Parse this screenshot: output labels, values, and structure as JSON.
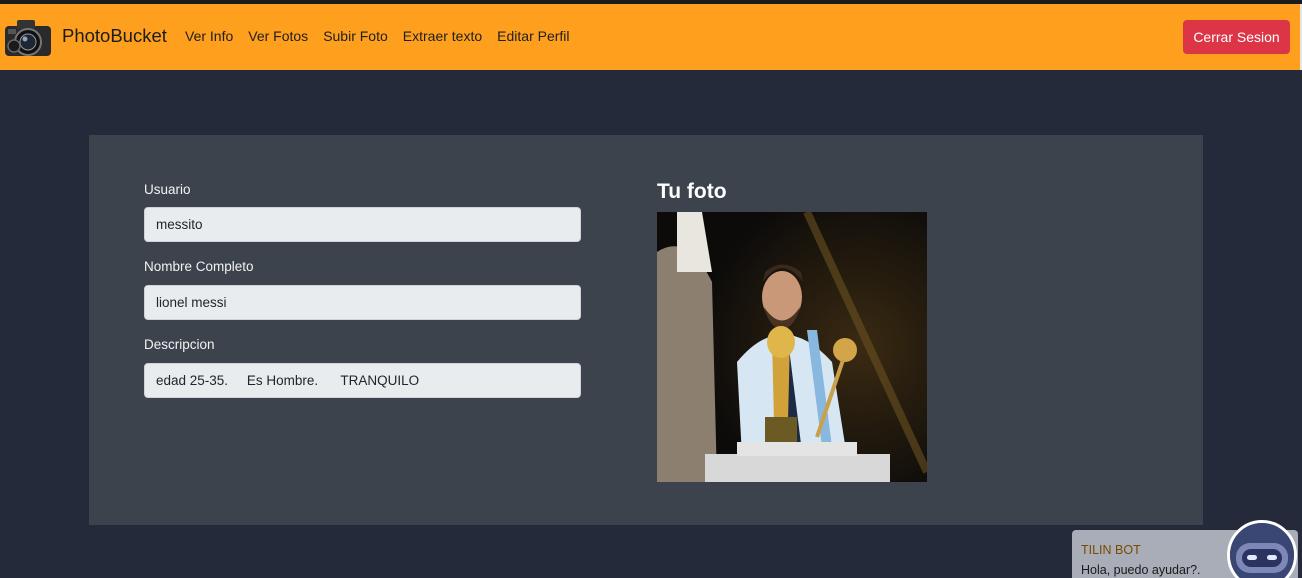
{
  "navbar": {
    "brand": "PhotoBucket",
    "links": [
      "Ver Info",
      "Ver Fotos",
      "Subir Foto",
      "Extraer texto",
      "Editar Perfil"
    ],
    "logout_label": "Cerrar Sesion",
    "accent_color": "#fe9f1e",
    "logout_color": "#dc3545"
  },
  "profile": {
    "user_label": "Usuario",
    "user_value": "messito",
    "fullname_label": "Nombre Completo",
    "fullname_value": "lionel messi",
    "description_label": "Descripcion",
    "description_value": "edad 25-35.     Es Hombre.      TRANQUILO"
  },
  "photo": {
    "title": "Tu foto"
  },
  "chatbot": {
    "name": "TILIN BOT",
    "message": "Hola, puedo ayudar?."
  }
}
